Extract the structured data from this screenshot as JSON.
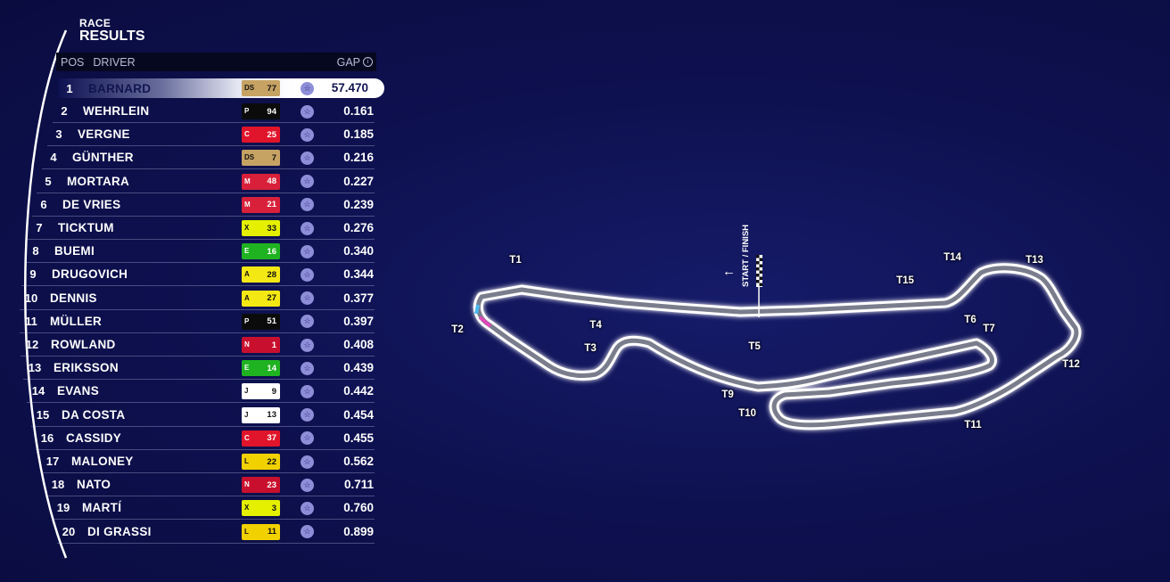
{
  "panel": {
    "title_line1": "RACE",
    "title_line2": "RESULTS"
  },
  "header": {
    "pos": "POS",
    "driver": "DRIVER",
    "gap": "GAP",
    "gap_info_icon": "info-icon"
  },
  "rows": [
    {
      "pos": "1",
      "driver": "BARNARD",
      "number": "77",
      "team_color": "#c6a263",
      "team_logo": "DS",
      "gap": "57.470"
    },
    {
      "pos": "2",
      "driver": "WEHRLEIN",
      "number": "94",
      "team_color": "#0b0b0b",
      "team_logo": "P",
      "gap": "0.161"
    },
    {
      "pos": "3",
      "driver": "VERGNE",
      "number": "25",
      "team_color": "#e0142a",
      "team_logo": "C",
      "gap": "0.185"
    },
    {
      "pos": "4",
      "driver": "GÜNTHER",
      "number": "7",
      "team_color": "#c6a263",
      "team_logo": "DS",
      "gap": "0.216"
    },
    {
      "pos": "5",
      "driver": "MORTARA",
      "number": "48",
      "team_color": "#d8203a",
      "team_logo": "M",
      "gap": "0.227"
    },
    {
      "pos": "6",
      "driver": "DE VRIES",
      "number": "21",
      "team_color": "#d8203a",
      "team_logo": "M",
      "gap": "0.239"
    },
    {
      "pos": "7",
      "driver": "TICKTUM",
      "number": "33",
      "team_color": "#e4f000",
      "team_logo": "X",
      "gap": "0.276"
    },
    {
      "pos": "8",
      "driver": "BUEMI",
      "number": "16",
      "team_color": "#1fb321",
      "team_logo": "E",
      "gap": "0.340"
    },
    {
      "pos": "9",
      "driver": "DRUGOVICH",
      "number": "28",
      "team_color": "#f4e814",
      "team_logo": "A",
      "gap": "0.344"
    },
    {
      "pos": "10",
      "driver": "DENNIS",
      "number": "27",
      "team_color": "#f4e814",
      "team_logo": "A",
      "gap": "0.377"
    },
    {
      "pos": "11",
      "driver": "MÜLLER",
      "number": "51",
      "team_color": "#0b0b0b",
      "team_logo": "P",
      "gap": "0.397"
    },
    {
      "pos": "12",
      "driver": "ROWLAND",
      "number": "1",
      "team_color": "#c8102e",
      "team_logo": "N",
      "gap": "0.408"
    },
    {
      "pos": "13",
      "driver": "ERIKSSON",
      "number": "14",
      "team_color": "#1fb321",
      "team_logo": "E",
      "gap": "0.439"
    },
    {
      "pos": "14",
      "driver": "EVANS",
      "number": "9",
      "team_color": "#ffffff",
      "team_logo": "J",
      "gap": "0.442"
    },
    {
      "pos": "15",
      "driver": "DA COSTA",
      "number": "13",
      "team_color": "#ffffff",
      "team_logo": "J",
      "gap": "0.454"
    },
    {
      "pos": "16",
      "driver": "CASSIDY",
      "number": "37",
      "team_color": "#e0142a",
      "team_logo": "C",
      "gap": "0.455"
    },
    {
      "pos": "17",
      "driver": "MALONEY",
      "number": "22",
      "team_color": "#f2d100",
      "team_logo": "L",
      "gap": "0.562"
    },
    {
      "pos": "18",
      "driver": "NATO",
      "number": "23",
      "team_color": "#c8102e",
      "team_logo": "N",
      "gap": "0.711"
    },
    {
      "pos": "19",
      "driver": "MARTÍ",
      "number": "3",
      "team_color": "#e4f000",
      "team_logo": "X",
      "gap": "0.760"
    },
    {
      "pos": "20",
      "driver": "DI GRASSI",
      "number": "11",
      "team_color": "#f2d100",
      "team_logo": "L",
      "gap": "0.899"
    }
  ],
  "track": {
    "turns": [
      "T1",
      "T2",
      "T3",
      "T4",
      "T5",
      "T6",
      "T7",
      "T9",
      "T10",
      "T11",
      "T12",
      "T13",
      "T14",
      "T15"
    ],
    "start_finish_label": "START / FINISH",
    "direction_icon": "arrow-left-icon"
  },
  "colors": {
    "background": "#0e1150",
    "header_bg": "#06081f",
    "fan_boost": "#8e8ed8"
  }
}
